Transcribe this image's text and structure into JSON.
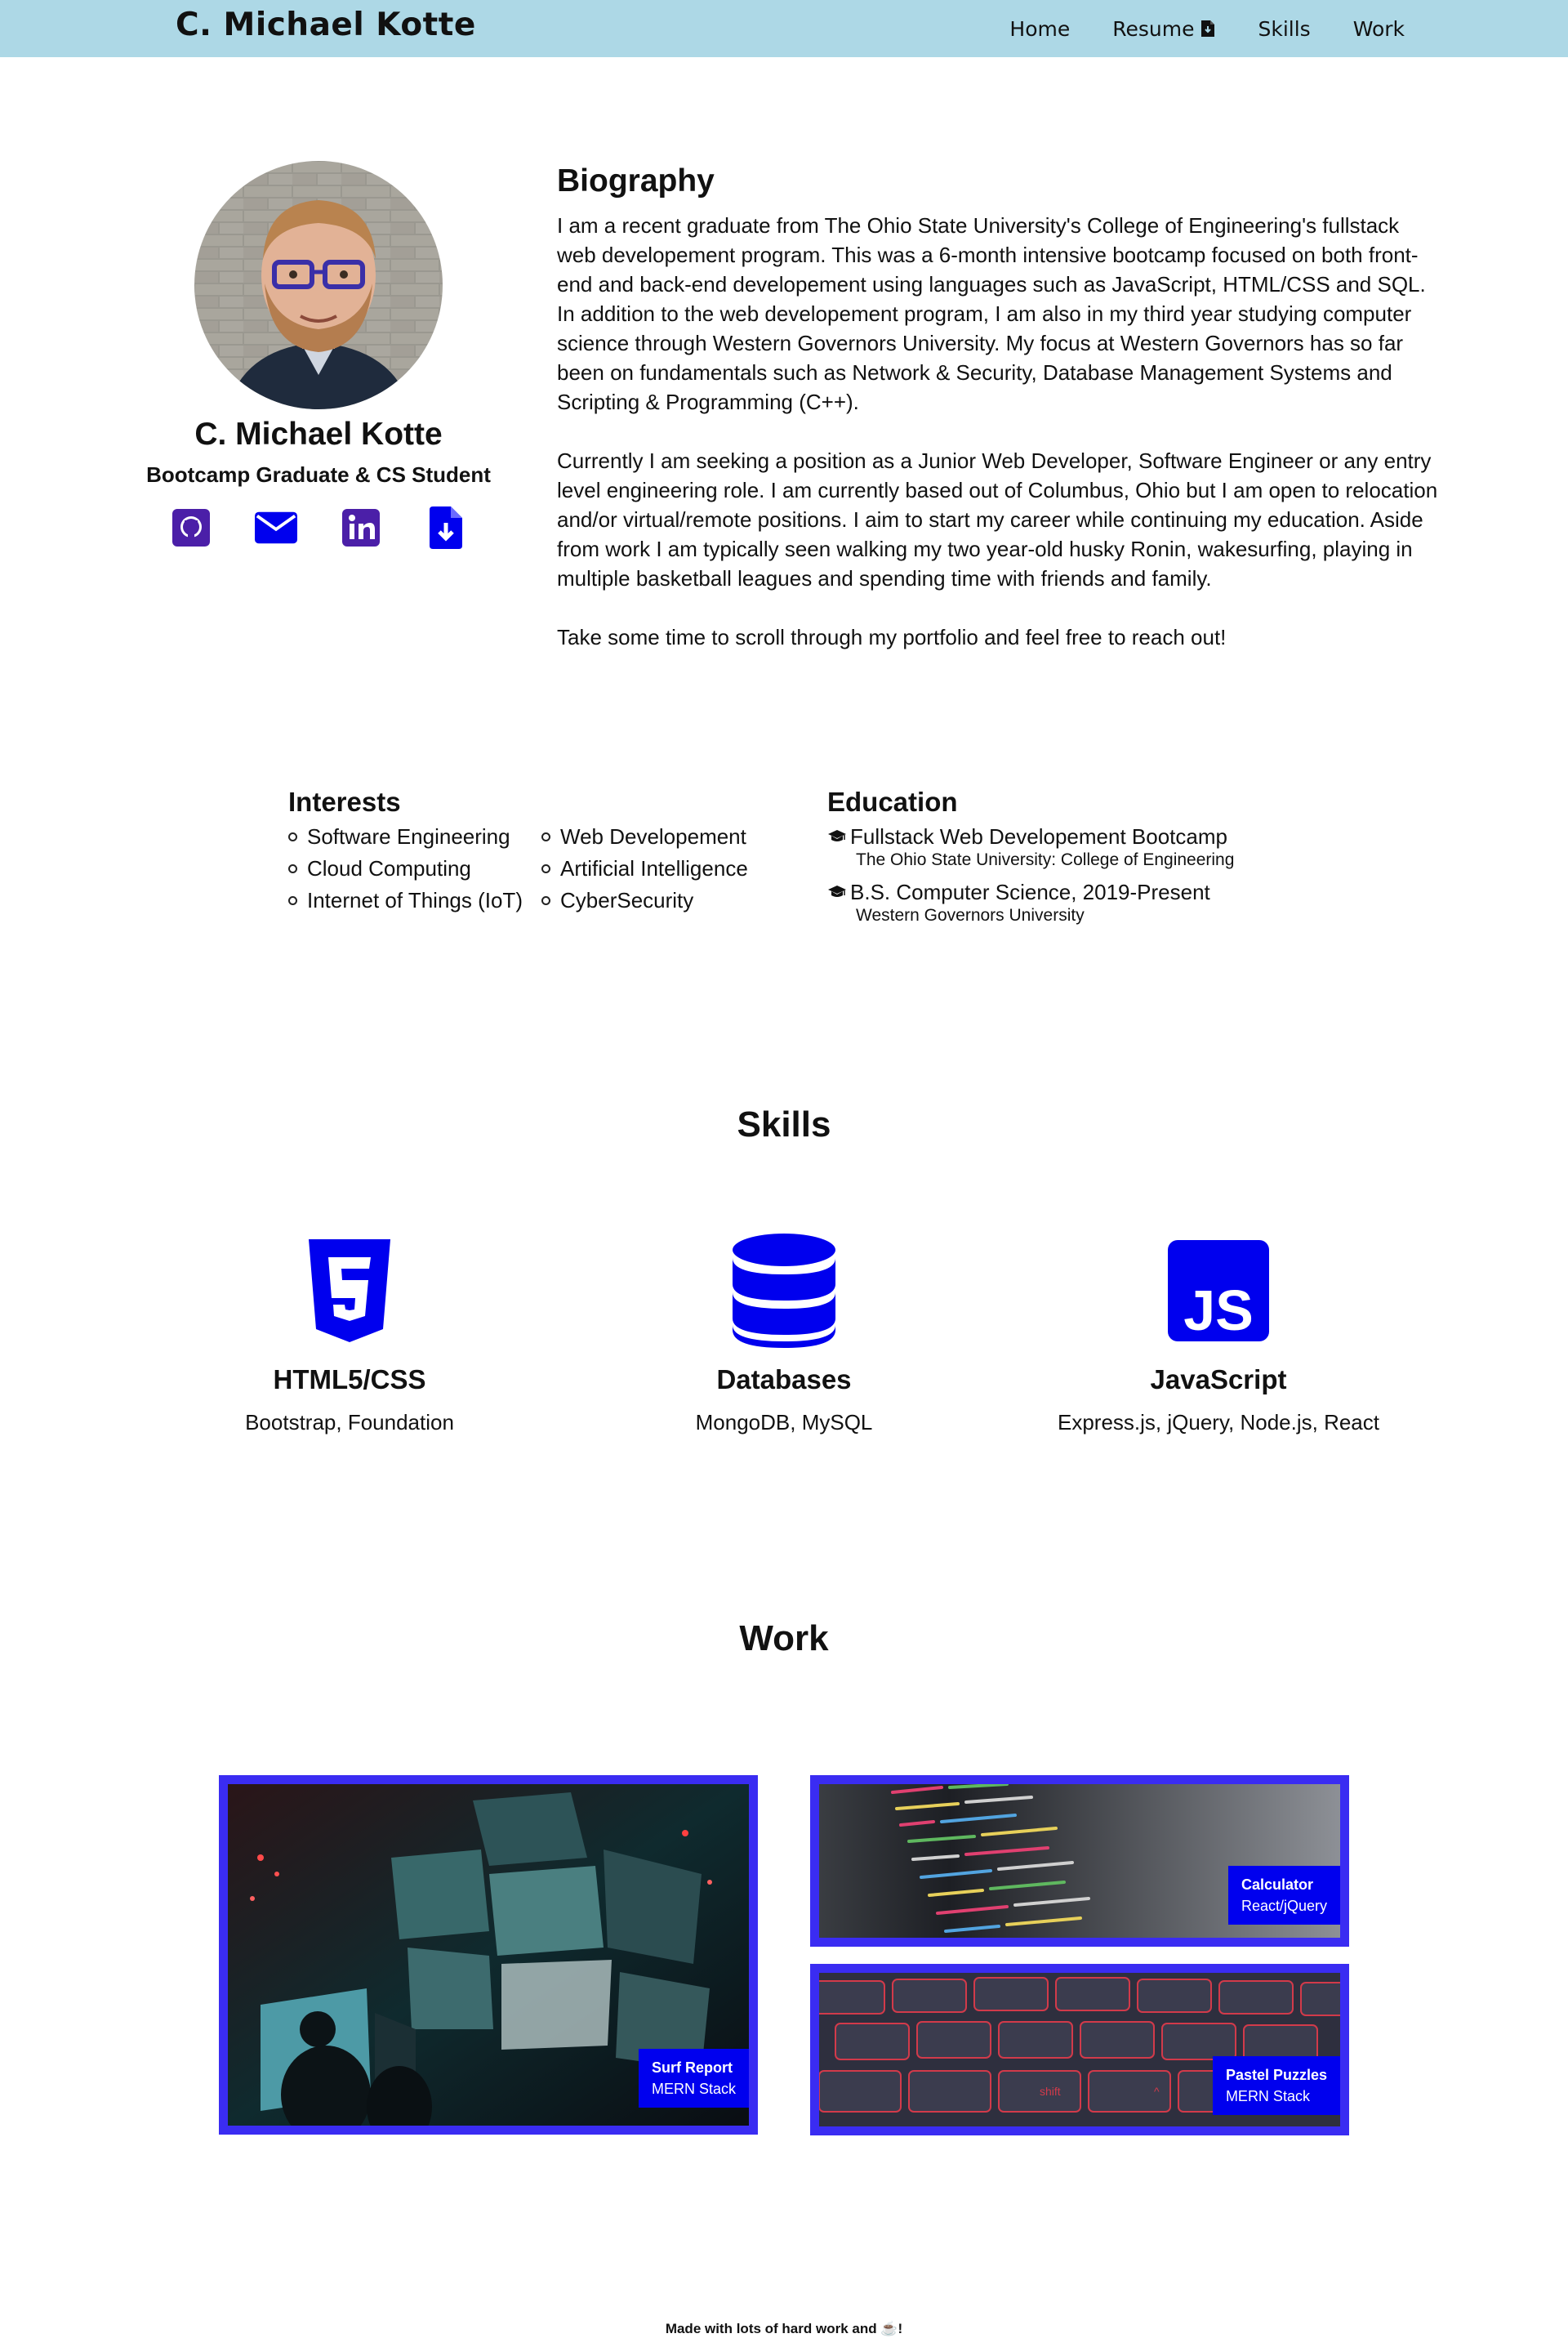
{
  "nav": {
    "brand": "C. Michael Kotte",
    "links": [
      {
        "label": "Home"
      },
      {
        "label": "Resume",
        "icon": "file-download-icon"
      },
      {
        "label": "Skills"
      },
      {
        "label": "Work"
      }
    ]
  },
  "profile": {
    "name": "C. Michael Kotte",
    "subtitle": "Bootcamp Graduate & CS Student",
    "socials": [
      "github-icon",
      "email-icon",
      "linkedin-icon",
      "resume-download-icon"
    ],
    "icon_color": "#4b1fa8"
  },
  "bio": {
    "title": "Biography",
    "paragraphs": [
      "I am a recent graduate from The Ohio State University's College of Engineering's fullstack web developement program. This was a 6-month intensive bootcamp focused on both front-end and back-end developement using languages such as JavaScript, HTML/CSS and SQL. In addition to the web developement program, I am also in my third year studying computer science through Western Governors University. My focus at Western Governors has so far been on fundamentals such as Network & Security, Database Management Systems and Scripting & Programming (C++).",
      "Currently I am seeking a position as a Junior Web Developer, Software Engineer or any entry level engineering role. I am currently based out of Columbus, Ohio but I am open to relocation and/or virtual/remote positions. I aim to start my career while continuing my education. Aside from work I am typically seen walking my two year-old husky Ronin, wakesurfing, playing in multiple basketball leagues and spending time with friends and family.",
      "Take some time to scroll through my portfolio and feel free to reach out!"
    ]
  },
  "interests": {
    "title": "Interests",
    "items": [
      "Software Engineering",
      "Web Developement",
      "Cloud Computing",
      "Artificial Intelligence",
      "Internet of Things (IoT)",
      "CyberSecurity"
    ]
  },
  "education": {
    "title": "Education",
    "items": [
      {
        "degree": "Fullstack Web Developement Bootcamp",
        "school": "The Ohio State University: College of Engineering"
      },
      {
        "degree": "B.S. Computer Science, 2019-Present",
        "school": "Western Governors University"
      }
    ]
  },
  "skills": {
    "title": "Skills",
    "items": [
      {
        "name": "HTML5/CSS",
        "desc": "Bootstrap, Foundation",
        "icon": "html5-icon"
      },
      {
        "name": "Databases",
        "desc": "MongoDB, MySQL",
        "icon": "database-icon"
      },
      {
        "name": "JavaScript",
        "desc": "Express.js, jQuery, Node.js, React",
        "icon": "javascript-icon"
      }
    ],
    "icon_color": "#0000ee"
  },
  "work": {
    "title": "Work",
    "items": [
      {
        "name": "Surf Report",
        "stack": "MERN Stack"
      },
      {
        "name": "Calculator",
        "stack": "React/jQuery"
      },
      {
        "name": "Pastel Puzzles",
        "stack": "MERN Stack"
      }
    ],
    "border_color": "#3a2cf2",
    "label_color": "#0000ee"
  },
  "footer": {
    "text": "Made with lots of hard work and ",
    "emoji": "☕",
    "end": "!"
  }
}
